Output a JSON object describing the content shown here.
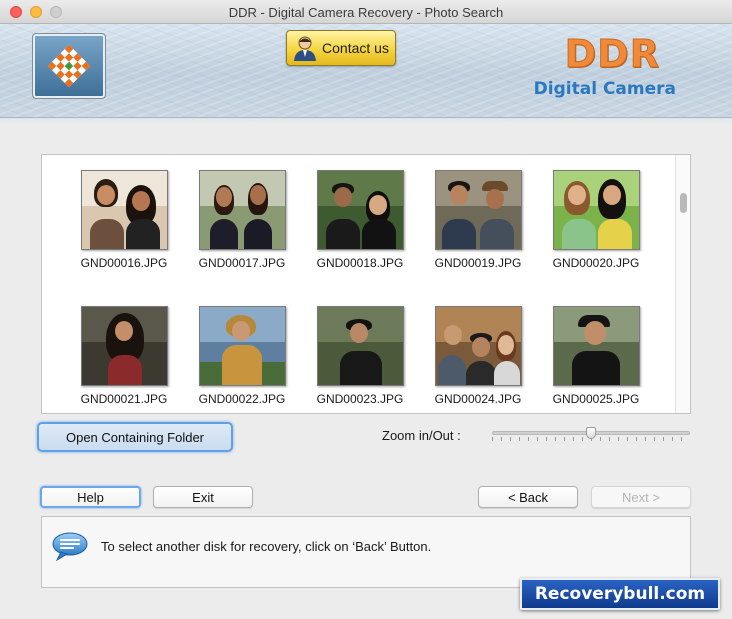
{
  "window": {
    "title": "DDR - Digital Camera Recovery - Photo Search"
  },
  "header": {
    "contact_label": "Contact us",
    "brand_name": "DDR",
    "brand_subtitle": "Digital Camera"
  },
  "gallery": {
    "items": [
      {
        "name": "GND00016.JPG"
      },
      {
        "name": "GND00017.JPG"
      },
      {
        "name": "GND00018.JPG"
      },
      {
        "name": "GND00019.JPG"
      },
      {
        "name": "GND00020.JPG"
      },
      {
        "name": "GND00021.JPG"
      },
      {
        "name": "GND00022.JPG"
      },
      {
        "name": "GND00023.JPG"
      },
      {
        "name": "GND00024.JPG"
      },
      {
        "name": "GND00025.JPG"
      }
    ]
  },
  "controls": {
    "open_folder_label": "Open Containing Folder",
    "zoom_label": "Zoom in/Out :",
    "zoom_level": 0.5
  },
  "buttons": {
    "help": "Help",
    "exit": "Exit",
    "back": "< Back",
    "next": "Next >"
  },
  "status": {
    "message": "To select another disk for recovery, click on ‘Back’ Button."
  },
  "watermark": {
    "text": "Recoverybull.com"
  },
  "colors": {
    "accent": "#5fa1e8",
    "brand_orange": "#f08a3a",
    "brand_blue": "#2a78c0"
  }
}
